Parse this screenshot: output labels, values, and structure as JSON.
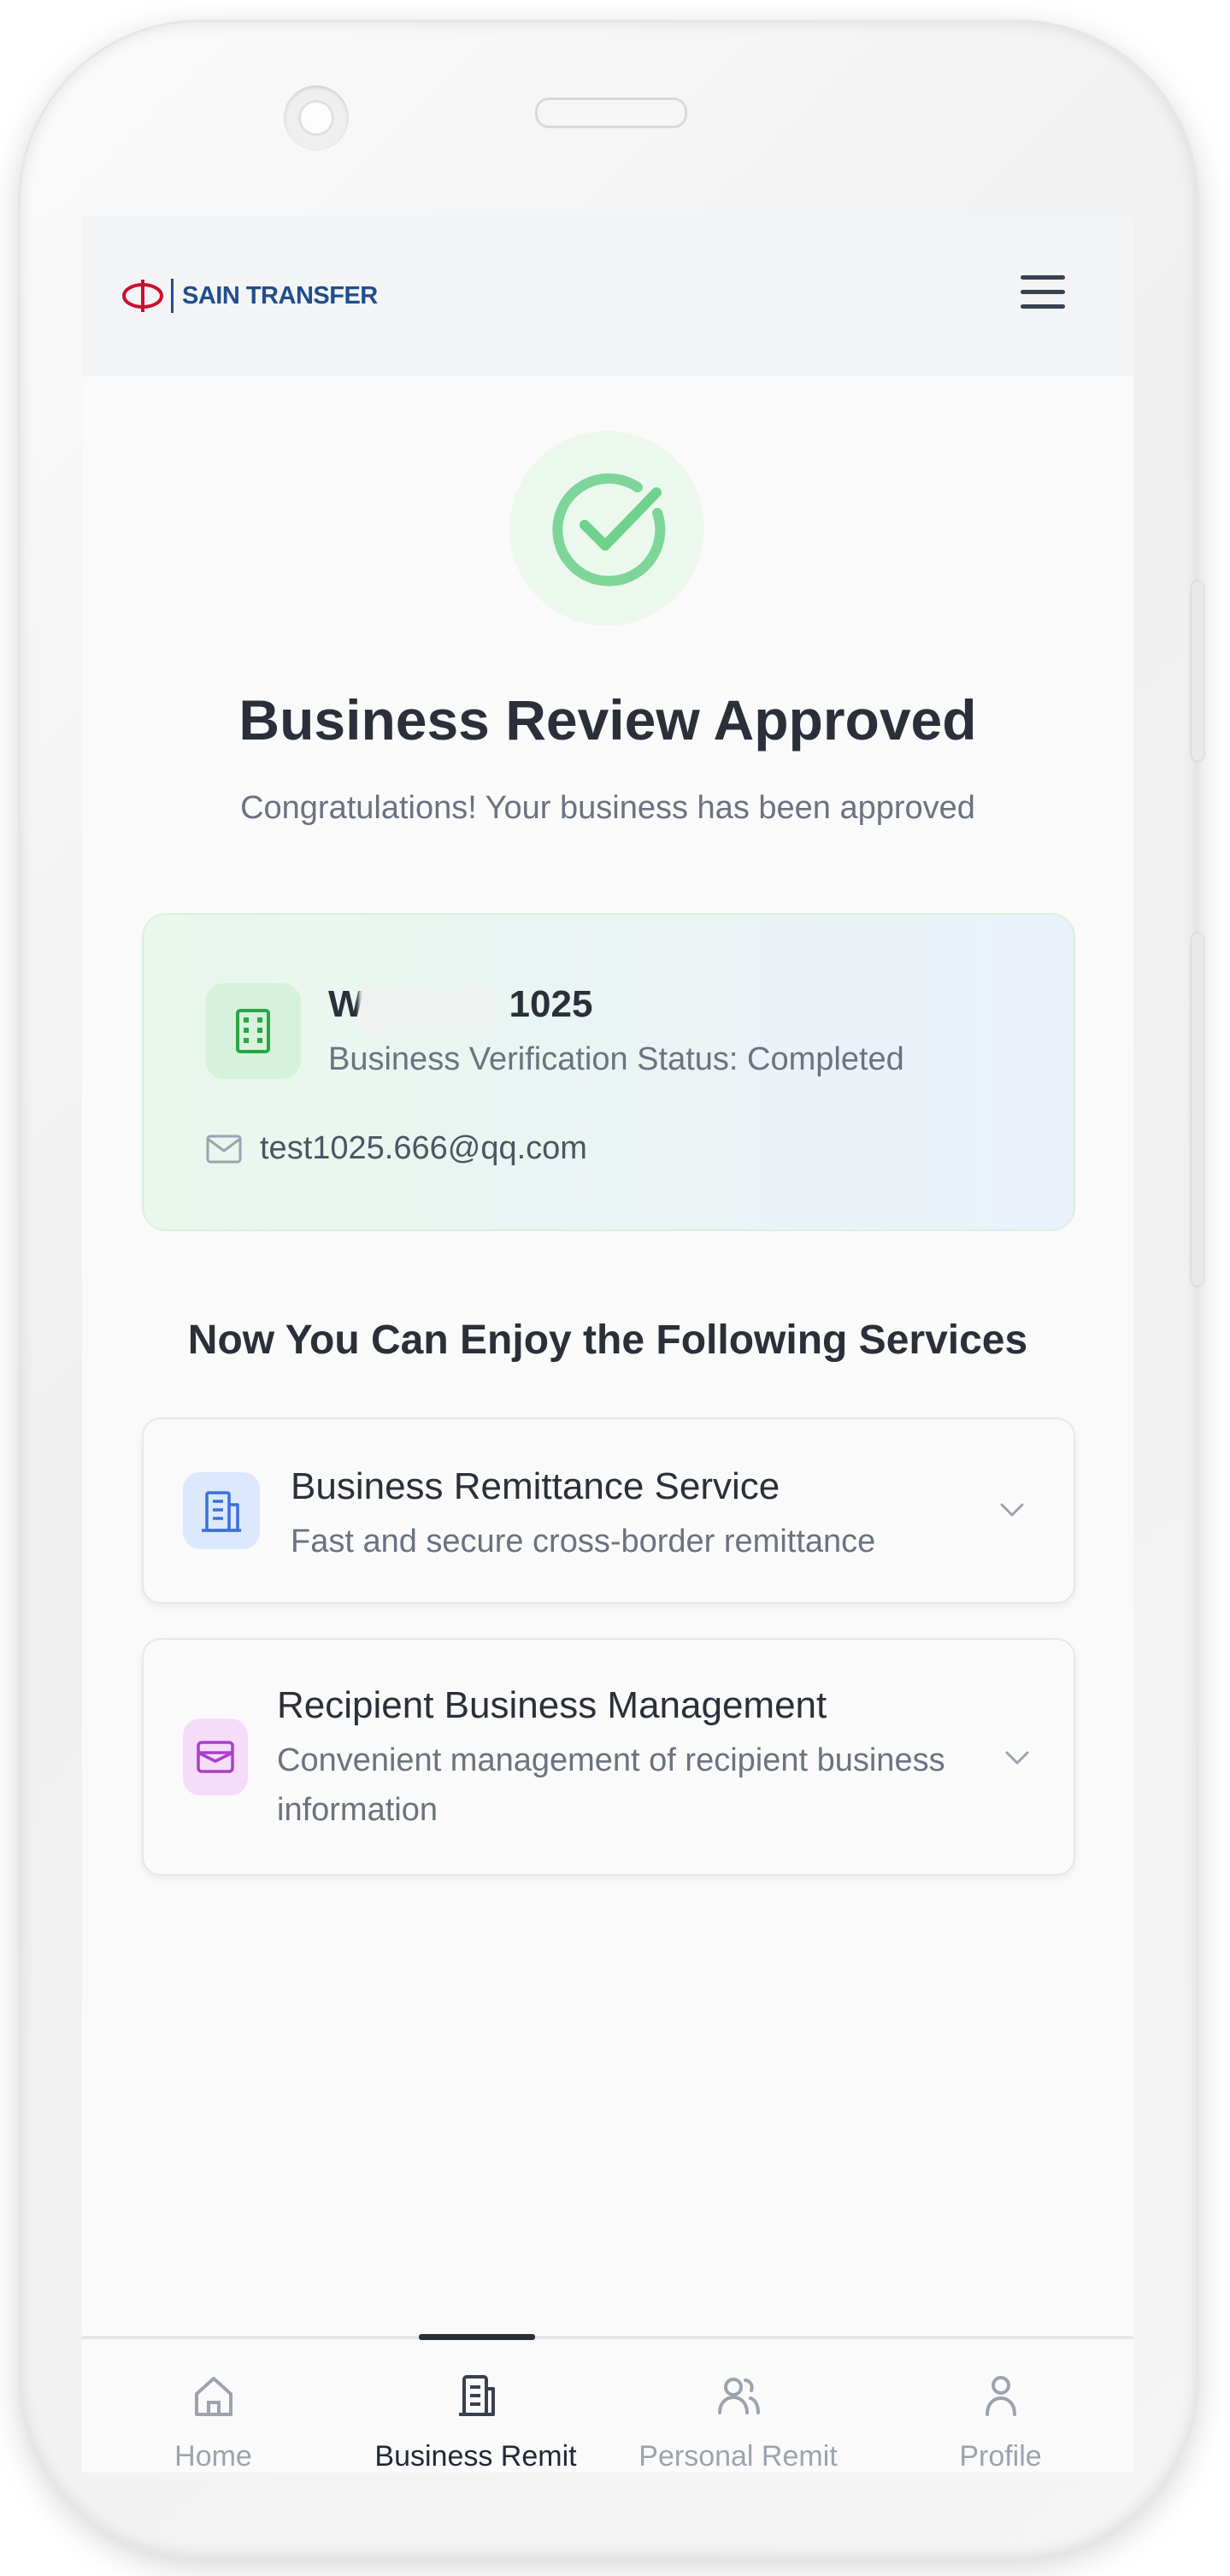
{
  "header": {
    "brand": "SAIN TRANSFER",
    "menu_icon": "hamburger-menu-icon"
  },
  "status": {
    "icon": "check-circle-icon",
    "title": "Business Review Approved",
    "subtitle": "Congratulations! Your business has been approved"
  },
  "business": {
    "icon": "building-icon",
    "name_visible_prefix": "W",
    "name_visible_suffix": "1025",
    "status": "Business Verification Status: Completed",
    "email_icon": "mail-icon",
    "email": "test1025.666@qq.com"
  },
  "services": {
    "heading": "Now You Can Enjoy the Following Services",
    "items": [
      {
        "icon": "building-icon",
        "title": "Business Remittance Service",
        "description": "Fast and secure cross-border remittance"
      },
      {
        "icon": "wallet-icon",
        "title": "Recipient Business Management",
        "description_line1": "Convenient management of recipient business",
        "description_line2": "information"
      }
    ]
  },
  "tabbar": {
    "tabs": [
      {
        "label": "Home",
        "icon": "home-icon"
      },
      {
        "label": "Business Remit",
        "icon": "document-icon",
        "active": true
      },
      {
        "label": "Personal Remit",
        "icon": "users-icon"
      },
      {
        "label": "Profile",
        "icon": "user-icon"
      }
    ]
  },
  "colors": {
    "success_green": "#6fd28c",
    "brand_blue": "#1f4e8c",
    "brand_red": "#c8102e",
    "service_blue": "#3b6fd8",
    "service_purple": "#a640c9"
  }
}
